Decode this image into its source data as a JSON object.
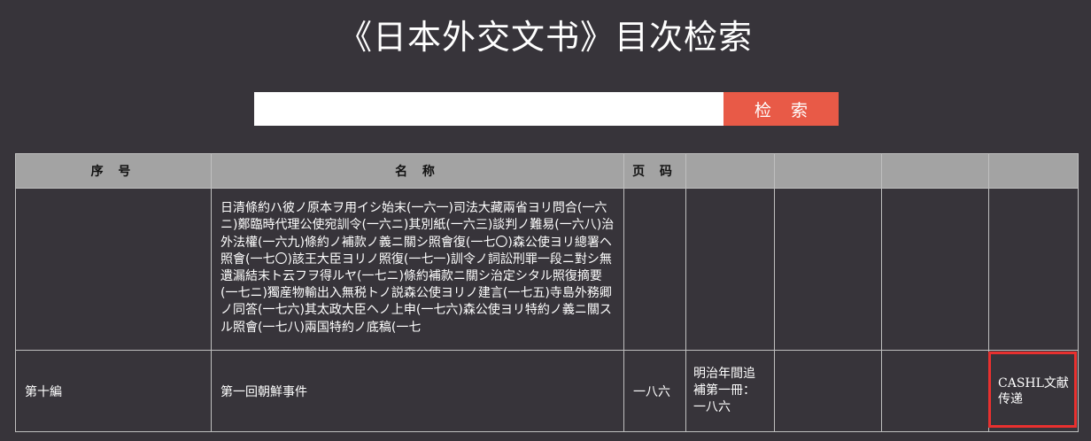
{
  "page": {
    "title": "《日本外交文书》目次检索"
  },
  "search": {
    "value": "",
    "placeholder": "",
    "button_label": "检 索"
  },
  "table": {
    "headers": [
      "序 号",
      "名 称",
      "页 码",
      "",
      "",
      "",
      ""
    ],
    "rows": [
      {
        "seq": "",
        "name": "日清條約ハ彼ノ原本ヲ用イシ始末(一六一)司法大藏兩省ヨリ問合(一六ニ)鄭臨時代理公使宛訓令(一六ニ)其別紙(一六三)談判ノ難易(一六八)治外法權(一六九)條約ノ補款ノ義ニ關シ照會復(一七〇)森公使ヨリ總署ヘ照會(一七〇)該王大臣ヨリノ照復(一七一)訓令ノ詞訟刑罪一段ニ對シ無遺漏結末ト云フヲ得ルヤ(一七ニ)條約補款ニ關シ治定シタル照復摘要(一七ニ)獨産物輸出入無税トノ説森公使ヨリノ建言(一七五)寺島外務卿ノ同答(一七六)其太政大臣ヘノ上申(一七六)森公使ヨリ特約ノ義ニ關スル照會(一七八)兩国特約ノ底稿(一七",
        "page": "",
        "source": "",
        "link": ""
      },
      {
        "seq": "第十編",
        "name": "第一回朝鮮事件",
        "page": "一八六",
        "source": "明治年間追補第一冊：一八六",
        "link": "CASHL文献传递"
      }
    ]
  }
}
